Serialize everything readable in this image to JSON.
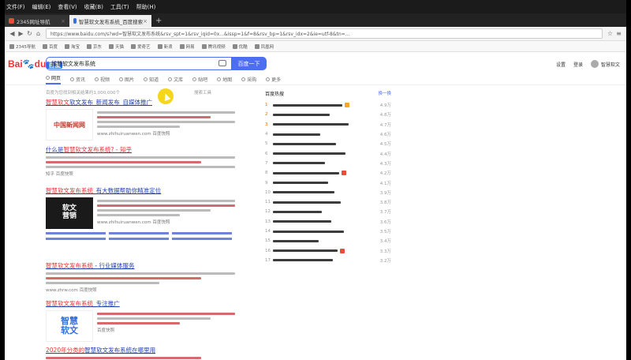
{
  "menubar": [
    "文件(F)",
    "编辑(E)",
    "查看(V)",
    "收藏(B)",
    "工具(T)",
    "帮助(H)"
  ],
  "tabs": [
    {
      "label": "2345网址导航",
      "active": false,
      "color": "#e74c3c"
    },
    {
      "label": "智慧软文发布系统_百度搜索",
      "active": true,
      "color": "#3b6de0"
    }
  ],
  "new_tab": "+",
  "address": {
    "url": "https://www.baidu.com/s?wd=智慧软文发布系统&rsv_spt=1&rsv_iqid=0x...&issp=1&f=8&rsv_bp=1&rsv_idx=2&ie=utf-8&tn=..."
  },
  "bookmarks": [
    "2345导航",
    "百度",
    "淘宝",
    "京东",
    "天猫",
    "爱奇艺",
    "新浪",
    "网易",
    "腾讯视频",
    "优酷",
    "凤凰网"
  ],
  "header": {
    "logo_a": "Bai",
    "logo_b": "du",
    "logo_c": "百度",
    "query": "智慧软文发布系统",
    "search_button": "百度一下",
    "settings": "设置",
    "login": "登录",
    "user": "智慧软文"
  },
  "filters": [
    "网页",
    "资讯",
    "视频",
    "图片",
    "知道",
    "文库",
    "贴吧",
    "地图",
    "采购",
    "更多"
  ],
  "stats": "百度为您找到相关结果约1,000,000个",
  "tools": "搜索工具",
  "results": [
    {
      "t1": "智慧软文",
      "t2": "软文发布_新闻发布_自媒体推广",
      "source": "www.zhihuiruanwen.com  百度快照"
    },
    {
      "t1": "什么是",
      "t2": "智慧软文发布系统? - 知乎",
      "source": "知乎  百度快照"
    },
    {
      "t1": "智慧软文发布系统",
      "t2": "_有大数据帮助你精准定位",
      "source": "www.zhihuiruanwen.com  百度快照"
    },
    {
      "t1": "智慧软文发布系统",
      "t2": " - 行业媒体服务",
      "source": "www.zhrw.com  百度快照"
    },
    {
      "t1": "智慧软文发布系统",
      "t2": "_专注推广",
      "source": "百度快照"
    },
    {
      "t1": "2020年分类的",
      "t2": "智慧软文发布系统在哪里用",
      "source": ""
    }
  ],
  "thumb_texts": {
    "r1": "中国新闻网",
    "r3a": "软文",
    "r3b": "营销",
    "r5a": "智慧",
    "r5b": "软文"
  },
  "hot": {
    "title": "百度热搜",
    "refresh": "换一换",
    "items": [
      {
        "rank": "1",
        "val": "4.9万"
      },
      {
        "rank": "2",
        "val": "4.8万"
      },
      {
        "rank": "3",
        "val": "4.7万"
      },
      {
        "rank": "4",
        "val": "4.6万"
      },
      {
        "rank": "5",
        "val": "4.5万"
      },
      {
        "rank": "6",
        "val": "4.4万"
      },
      {
        "rank": "7",
        "val": "4.3万"
      },
      {
        "rank": "8",
        "val": "4.2万"
      },
      {
        "rank": "9",
        "val": "4.1万"
      },
      {
        "rank": "10",
        "val": "3.9万"
      },
      {
        "rank": "11",
        "val": "3.8万"
      },
      {
        "rank": "12",
        "val": "3.7万"
      },
      {
        "rank": "13",
        "val": "3.6万"
      },
      {
        "rank": "14",
        "val": "3.5万"
      },
      {
        "rank": "15",
        "val": "3.4万"
      },
      {
        "rank": "16",
        "val": "3.3万"
      },
      {
        "rank": "17",
        "val": "3.2万"
      }
    ]
  },
  "colors": {
    "accent": "#4e6ef2",
    "link": "#2440b3",
    "highlight": "#e33333",
    "cursor": "#f5d200"
  }
}
